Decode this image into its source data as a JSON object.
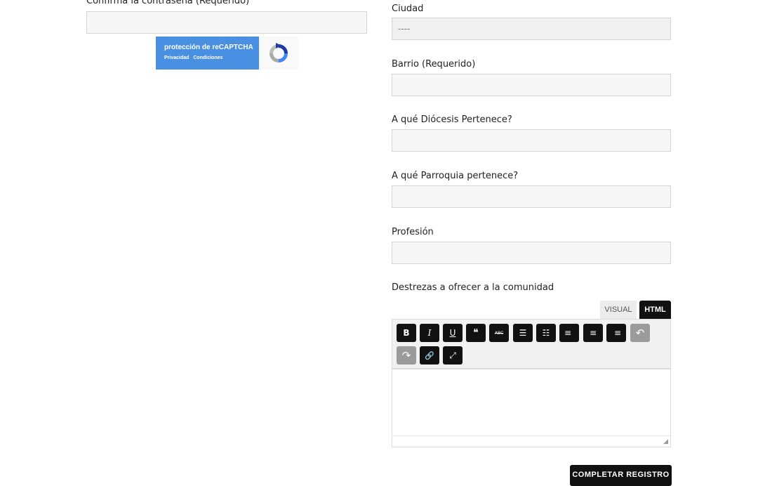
{
  "left": {
    "confirm_password_label": "Confirma la contraseña (Requerido)",
    "confirm_password_value": "",
    "recaptcha": {
      "title": "protección de reCAPTCHA",
      "privacy": "Privacidad",
      "terms": "Condiciones"
    }
  },
  "right": {
    "ciudad": {
      "label": "Ciudad",
      "value": "----"
    },
    "barrio": {
      "label": "Barrio (Requerido)",
      "value": ""
    },
    "diocesis": {
      "label": "A qué Diócesis Pertenece?",
      "value": ""
    },
    "parroquia": {
      "label": "A qué Parroquia pertenece?",
      "value": ""
    },
    "profesion": {
      "label": "Profesión",
      "value": ""
    },
    "destrezas": {
      "label": "Destrezas a ofrecer a la comunidad",
      "value": ""
    }
  },
  "editor": {
    "tabs": [
      "VISUAL",
      "HTML"
    ],
    "active_tab": "HTML",
    "toolbar": [
      {
        "name": "bold-icon",
        "glyph": "B"
      },
      {
        "name": "italic-icon",
        "glyph": "I"
      },
      {
        "name": "underline-icon",
        "glyph": "U"
      },
      {
        "name": "blockquote-icon",
        "glyph": "❝"
      },
      {
        "name": "strikethrough-icon",
        "glyph": "ABC"
      },
      {
        "name": "bullet-list-icon",
        "glyph": "☰"
      },
      {
        "name": "numbered-list-icon",
        "glyph": "☷"
      },
      {
        "name": "align-left-icon",
        "glyph": "≡"
      },
      {
        "name": "align-center-icon",
        "glyph": "≡"
      },
      {
        "name": "align-right-icon",
        "glyph": "≡"
      },
      {
        "name": "undo-icon",
        "glyph": "↶",
        "disabled": true
      },
      {
        "name": "redo-icon",
        "glyph": "↷",
        "disabled": true
      },
      {
        "name": "link-icon",
        "glyph": "🔗"
      },
      {
        "name": "fullscreen-icon",
        "glyph": "⤢"
      }
    ]
  },
  "submit_label": "COMPLETAR REGISTRO"
}
